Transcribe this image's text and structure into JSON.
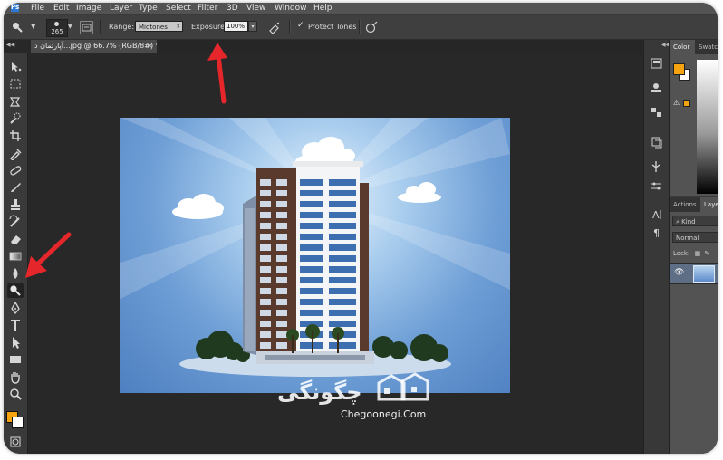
{
  "menu": {
    "logo": "Ps",
    "items": [
      "File",
      "Edit",
      "Image",
      "Layer",
      "Type",
      "Select",
      "Filter",
      "3D",
      "View",
      "Window",
      "Help"
    ]
  },
  "options_bar": {
    "tool_icon": "dodge-icon",
    "brush_size": "265",
    "range_label": "Range:",
    "range_value": "Midtones",
    "exposure_label": "Exposure:",
    "exposure_value": "100%",
    "protect_tones_label": "Protect Tones",
    "protect_tones_checked": true,
    "airbrush_icon": "airbrush-icon",
    "pressure_icon": "pressure-icon"
  },
  "document": {
    "tab_title": "آپارتمان د...jpg @ 66.7% (RGB/8#) *",
    "close_glyph": "×"
  },
  "toolbox": {
    "tools": [
      "move-tool-icon",
      "marquee-tool-icon",
      "lasso-tool-icon",
      "quick-select-tool-icon",
      "crop-tool-icon",
      "eyedropper-tool-icon",
      "healing-brush-tool-icon",
      "brush-tool-icon",
      "clone-stamp-tool-icon",
      "history-brush-tool-icon",
      "eraser-tool-icon",
      "gradient-tool-icon",
      "blur-tool-icon",
      "dodge-tool-icon",
      "pen-tool-icon",
      "type-tool-icon",
      "path-select-tool-icon",
      "rectangle-tool-icon",
      "hand-tool-icon",
      "zoom-tool-icon"
    ],
    "active_tool": "dodge-tool-icon",
    "foreground_color": "#f5a30f",
    "background_color": "#ffffff"
  },
  "right_panels": {
    "color_tabs": [
      "Color",
      "Swatch"
    ],
    "history_tabs": [
      "Actions",
      "Laye"
    ],
    "layers": {
      "kind_filter": "Kind",
      "blend_mode": "Normal",
      "lock_label": "Lock:"
    }
  },
  "watermark": {
    "persian": "چگونگی",
    "latin": "Chegoonegi.Com"
  },
  "colors": {
    "accent": "#f5a30f",
    "arrow": "#e5262b",
    "panel_bg": "#535353",
    "canvas_bg": "#282828"
  }
}
